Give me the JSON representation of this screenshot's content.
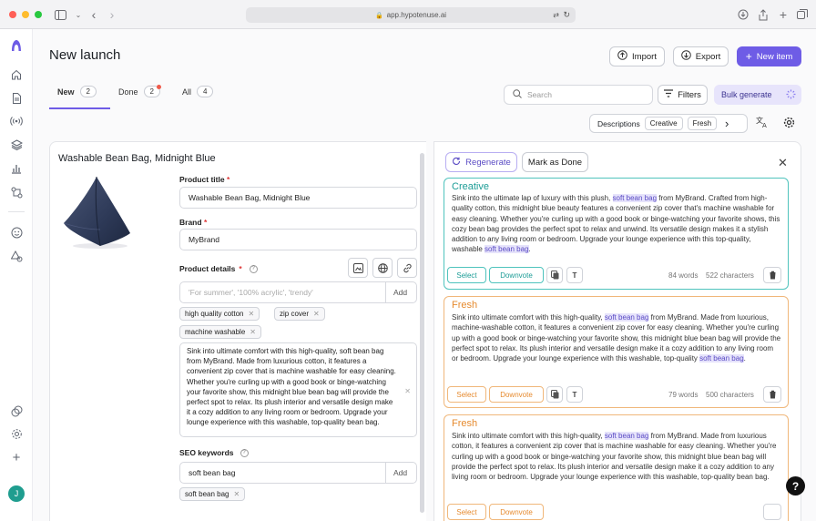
{
  "browser": {
    "url": "app.hypotenuse.ai"
  },
  "header": {
    "title": "New launch",
    "import_label": "Import",
    "export_label": "Export",
    "new_item_label": "New item"
  },
  "tabs": [
    {
      "label": "New",
      "count": "2"
    },
    {
      "label": "Done",
      "count": "2"
    },
    {
      "label": "All",
      "count": "4"
    }
  ],
  "toolbar": {
    "search_placeholder": "Search",
    "filters_label": "Filters",
    "bulk_generate_label": "Bulk generate",
    "descriptions_label": "Descriptions",
    "tone_chip": "Creative",
    "style_chip": "Fresh"
  },
  "product": {
    "heading": "Washable Bean Bag, Midnight Blue",
    "title_label": "Product title",
    "title_value": "Washable Bean Bag, Midnight Blue",
    "brand_label": "Brand",
    "brand_value": "MyBrand",
    "details_label": "Product details",
    "details_placeholder": "'For summer', '100% acrylic', 'trendy'",
    "add_label": "Add",
    "details_chips": [
      "high quality cotton",
      "zip cover",
      "machine washable"
    ],
    "description": "Sink into ultimate comfort with this high-quality, soft bean bag from MyBrand. Made from luxurious cotton, it features a convenient zip cover that is machine washable for easy cleaning. Whether you're curling up with a good book or binge-watching your favorite show, this midnight blue bean bag will provide the perfect spot to relax. Its plush interior and versatile design make it a cozy addition to any living room or bedroom. Upgrade your lounge experience with this washable, top-quality bean bag.",
    "seo_label": "SEO keywords",
    "seo_value": "soft bean bag",
    "seo_add_label": "Add",
    "seo_chips": [
      "soft bean bag"
    ]
  },
  "results": {
    "regenerate_label": "Regenerate",
    "mark_done_label": "Mark as Done",
    "cards": [
      {
        "title": "Creative",
        "title_color": "#1b9c96",
        "border_color": "#4fc3bd",
        "parts": [
          "Sink into the ultimate lap of luxury with this plush, ",
          "soft bean bag",
          " from MyBrand. Crafted from high-quality cotton, this midnight blue beauty features a convenient zip cover that's machine washable for easy cleaning. Whether you're curling up with a good book or binge-watching your favorite shows, this cozy bean bag provides the perfect spot to relax and unwind. Its versatile design makes it a stylish addition to any living room or bedroom. Upgrade your lounge experience with this top-quality, washable ",
          "soft bean bag",
          "."
        ],
        "select_label": "Select",
        "downvote_label": "Downvote",
        "words": "84 words",
        "chars": "522 characters"
      },
      {
        "title": "Fresh",
        "title_color": "#e68a2e",
        "border_color": "#f0b77a",
        "parts": [
          "Sink into ultimate comfort with this high-quality, ",
          "soft bean bag",
          " from MyBrand. Made from luxurious, machine-washable cotton, it features a convenient zip cover for easy cleaning. Whether you're curling up with a good book or binge-watching your favorite show, this midnight blue bean bag will provide the perfect spot to relax. Its plush interior and versatile design make it a cozy addition to any living room or bedroom. Upgrade your lounge experience with this washable, top-quality ",
          "soft bean bag",
          "."
        ],
        "select_label": "Select",
        "downvote_label": "Downvote",
        "words": "79 words",
        "chars": "500 characters"
      },
      {
        "title": "Fresh",
        "title_color": "#e68a2e",
        "border_color": "#f0b77a",
        "parts": [
          "Sink into ultimate comfort with this high-quality, ",
          "soft bean bag",
          " from MyBrand. Made from luxurious cotton, it features a convenient zip cover that is machine washable for easy cleaning. Whether you're curling up with a good book or binge-watching your favorite show, this midnight blue bean bag will provide the perfect spot to relax. Its plush interior and versatile design make it a cozy addition to any living room or bedroom. Upgrade your lounge experience with this washable, top-quality bean bag."
        ],
        "select_label": "Select",
        "downvote_label": "Downvote",
        "words": "",
        "chars": ""
      }
    ]
  },
  "avatar_initial": "J",
  "help_label": "?",
  "colors": {
    "accent": "#6e5ce6",
    "creative": "#1b9c96",
    "fresh": "#e68a2e"
  }
}
